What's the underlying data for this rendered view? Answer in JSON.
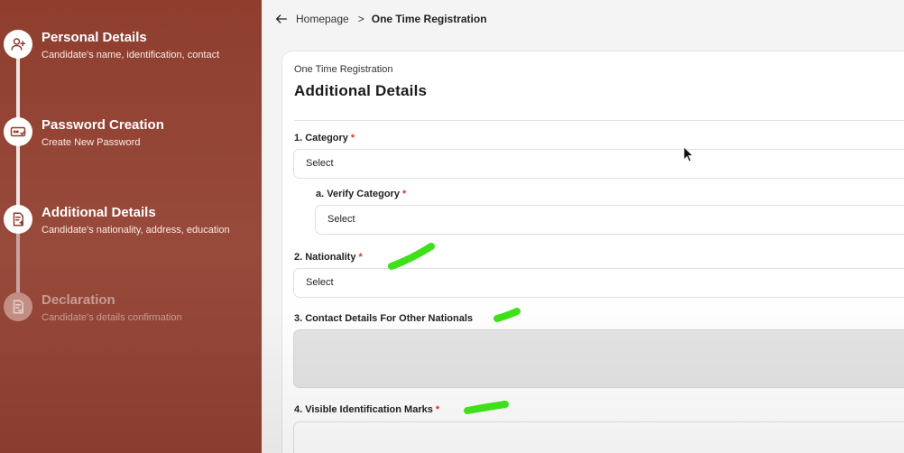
{
  "sidebar": {
    "steps": [
      {
        "title": "Personal Details",
        "desc": "Candidate's name, identification, contact",
        "icon": "add-user-icon"
      },
      {
        "title": "Password Creation",
        "desc": "Create New Password",
        "icon": "password-icon"
      },
      {
        "title": "Additional Details",
        "desc": "Candidate's nationality, address, education",
        "icon": "document-add-icon"
      },
      {
        "title": "Declaration",
        "desc": "Candidate's details confirmation",
        "icon": "document-check-icon"
      }
    ]
  },
  "breadcrumb": {
    "home": "Homepage",
    "separator": ">",
    "current": "One Time Registration"
  },
  "form": {
    "subtitle": "One Time Registration",
    "title": "Additional Details",
    "fields": {
      "category": {
        "label": "1. Category",
        "required": "*",
        "value": "Select"
      },
      "verify_category": {
        "label": "a. Verify Category",
        "required": "*",
        "value": "Select"
      },
      "nationality": {
        "label": "2. Nationality",
        "required": "*",
        "value": "Select"
      },
      "contact_other": {
        "label": "3. Contact Details For Other Nationals"
      },
      "identification_marks": {
        "label": "4. Visible Identification Marks",
        "required": "*"
      }
    }
  },
  "colors": {
    "sidebar_bg": "#8f3e2e",
    "required": "#d9342b",
    "annotation": "#3ee01a"
  }
}
